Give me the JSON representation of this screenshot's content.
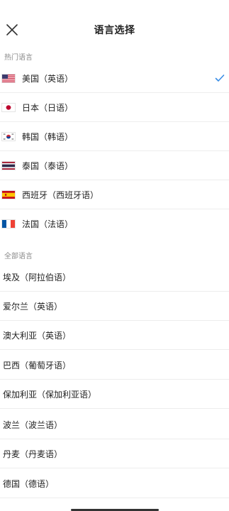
{
  "header": {
    "title": "语言选择",
    "close_icon": "close-icon"
  },
  "popular": {
    "label": "热门语言",
    "items": [
      {
        "name": "美国（英语）",
        "flag": "flag-us-icon",
        "selected": true
      },
      {
        "name": "日本（日语）",
        "flag": "flag-japan-icon",
        "selected": false
      },
      {
        "name": "韩国（韩语）",
        "flag": "flag-korea-icon",
        "selected": false
      },
      {
        "name": "泰国（泰语）",
        "flag": "flag-thailand-icon",
        "selected": false
      },
      {
        "name": "西班牙（西班牙语）",
        "flag": "flag-spain-icon",
        "selected": false
      },
      {
        "name": "法国（法语）",
        "flag": "flag-france-icon",
        "selected": false
      }
    ]
  },
  "all": {
    "label": "全部语言",
    "items": [
      {
        "name": "埃及（阿拉伯语）"
      },
      {
        "name": "爱尔兰（英语）"
      },
      {
        "name": "澳大利亚（英语）"
      },
      {
        "name": "巴西（葡萄牙语）"
      },
      {
        "name": "保加利亚（保加利亚语）"
      },
      {
        "name": "波兰（波兰语）"
      },
      {
        "name": "丹麦（丹麦语）"
      },
      {
        "name": "德国（德语）"
      }
    ]
  },
  "colors": {
    "accent": "#3a8ee6",
    "divider": "#ededed",
    "section_text": "#8a8a8a"
  }
}
